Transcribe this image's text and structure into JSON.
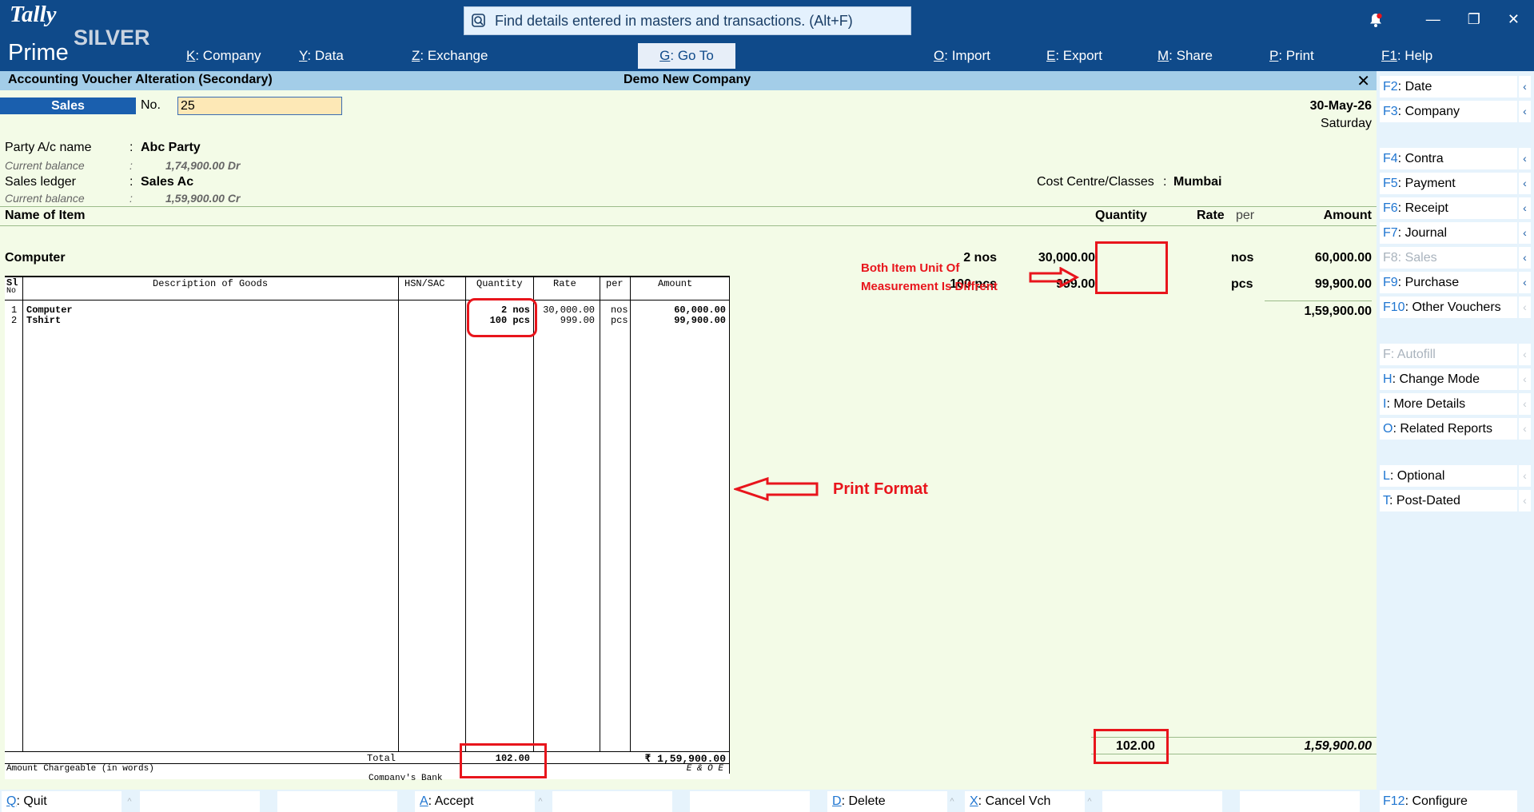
{
  "app": {
    "logo_top": "Tally",
    "logo_bottom": "Prime",
    "edition": "SILVER"
  },
  "search": {
    "placeholder": "Find details entered in masters and transactions. (Alt+F)"
  },
  "top_menu": [
    {
      "key": "K",
      "label": "Company"
    },
    {
      "key": "Y",
      "label": "Data"
    },
    {
      "key": "Z",
      "label": "Exchange"
    },
    {
      "key": "G",
      "label": "Go To"
    },
    {
      "key": "O",
      "label": "Import"
    },
    {
      "key": "E",
      "label": "Export"
    },
    {
      "key": "M",
      "label": "Share"
    },
    {
      "key": "P",
      "label": "Print"
    },
    {
      "key": "F1",
      "label": "Help"
    }
  ],
  "title_bar": {
    "screen": "Accounting Voucher Alteration (Secondary)",
    "company": "Demo New Company",
    "close": "✕"
  },
  "voucher": {
    "type": "Sales",
    "no_label": "No.",
    "no_value": "25",
    "date": "30-May-26",
    "day": "Saturday"
  },
  "party": {
    "label": "Party A/c name",
    "value": "Abc Party",
    "balance_label": "Current balance",
    "balance": "1,74,900.00 Dr"
  },
  "ledger": {
    "label": "Sales ledger",
    "value": "Sales Ac",
    "balance_label": "Current balance",
    "balance": "1,59,900.00 Cr"
  },
  "cost_centre": {
    "label": "Cost Centre/Classes",
    "value": "Mumbai"
  },
  "item_table": {
    "headers": {
      "name": "Name of Item",
      "quantity": "Quantity",
      "rate": "Rate",
      "per": "per",
      "amount": "Amount"
    },
    "group_label": "Computer",
    "rows": [
      {
        "qty": "2 nos",
        "rate": "30,000.00",
        "per": "nos",
        "amount": "60,000.00"
      },
      {
        "qty": "100 pcs",
        "rate": "999.00",
        "per": "pcs",
        "amount": "99,900.00"
      }
    ],
    "subtotal": "1,59,900.00",
    "total_qty": "102.00",
    "total_amount": "1,59,900.00"
  },
  "print_format": {
    "headers": {
      "sl": "Sl",
      "no": "No",
      "desc": "Description of Goods",
      "hsn": "HSN/SAC",
      "qty": "Quantity",
      "rate": "Rate",
      "per": "per",
      "amount": "Amount"
    },
    "rows": [
      {
        "sl": "1",
        "desc": "Computer",
        "qty": "2 nos",
        "rate": "30,000.00",
        "per": "nos",
        "amount": "60,000.00"
      },
      {
        "sl": "2",
        "desc": "Tshirt",
        "qty": "100 pcs",
        "rate": "999.00",
        "per": "pcs",
        "amount": "99,900.00"
      }
    ],
    "total_label": "Total",
    "total_qty": "102.00",
    "total_amount": "₹ 1,59,900.00",
    "amount_words_label": "Amount Chargeable (in words)",
    "eoe": "E & O E",
    "bank_label": "Company's Bank"
  },
  "annotations": {
    "unit_note_1": "Both Item Unit Of",
    "unit_note_2": "Measurement Is Diffrent",
    "print_note": "Print Format",
    "accent_color": "#e8151c"
  },
  "sidebar": [
    {
      "key": "F2",
      "label": "Date",
      "enabled": true
    },
    {
      "key": "F3",
      "label": "Company",
      "enabled": true
    },
    {
      "key": "F4",
      "label": "Contra",
      "enabled": true
    },
    {
      "key": "F5",
      "label": "Payment",
      "enabled": true
    },
    {
      "key": "F6",
      "label": "Receipt",
      "enabled": true
    },
    {
      "key": "F7",
      "label": "Journal",
      "enabled": true
    },
    {
      "key": "F8",
      "label": "Sales",
      "enabled": false
    },
    {
      "key": "F9",
      "label": "Purchase",
      "enabled": true
    },
    {
      "key": "F10",
      "label": "Other Vouchers",
      "enabled": true
    },
    {
      "key": "F",
      "label": "Autofill",
      "enabled": false
    },
    {
      "key": "H",
      "label": "Change Mode",
      "enabled": true
    },
    {
      "key": "I",
      "label": "More Details",
      "enabled": true
    },
    {
      "key": "O",
      "label": "Related Reports",
      "enabled": true
    },
    {
      "key": "L",
      "label": "Optional",
      "enabled": true
    },
    {
      "key": "T",
      "label": "Post-Dated",
      "enabled": true
    }
  ],
  "bottom_bar": [
    {
      "key": "Q",
      "label": "Quit"
    },
    {
      "key": "A",
      "label": "Accept"
    },
    {
      "key": "D",
      "label": "Delete"
    },
    {
      "key": "X",
      "label": "Cancel Vch"
    }
  ],
  "configure": {
    "key": "F12",
    "label": "Configure"
  },
  "colors": {
    "top_bar": "#0f4a8a",
    "title_bar": "#a3cde8",
    "body": "#f3fbe7",
    "sidebar": "#e6f3fc",
    "key_highlight": "#2076d1"
  }
}
